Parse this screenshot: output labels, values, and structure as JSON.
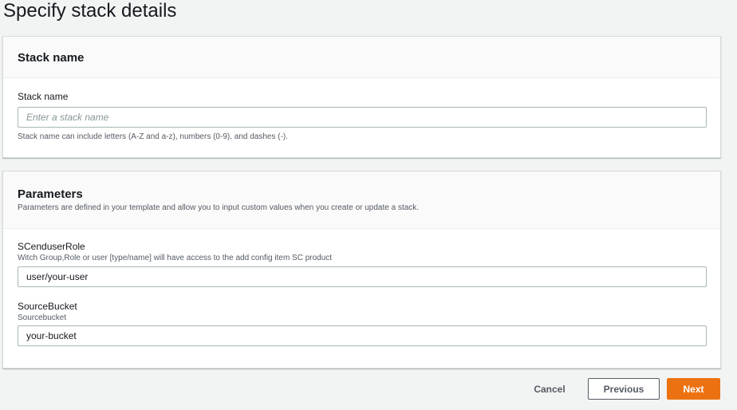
{
  "page_title": "Specify stack details",
  "stack_panel": {
    "title": "Stack name",
    "field_label": "Stack name",
    "placeholder": "Enter a stack name",
    "value": "",
    "hint": "Stack name can include letters (A-Z and a-z), numbers (0-9), and dashes (-)."
  },
  "params_panel": {
    "title": "Parameters",
    "description": "Parameters are defined in your template and allow you to input custom values when you create or update a stack.",
    "params": [
      {
        "name": "SCenduserRole",
        "description": "Witch Group,Role or user [type/name] will have access to the add config item SC product",
        "value": "user/your-user"
      },
      {
        "name": "SourceBucket",
        "description": "Sourcebucket",
        "value": "your-bucket"
      }
    ]
  },
  "footer": {
    "cancel": "Cancel",
    "previous": "Previous",
    "next": "Next"
  },
  "colors": {
    "primary": "#ec7211"
  }
}
